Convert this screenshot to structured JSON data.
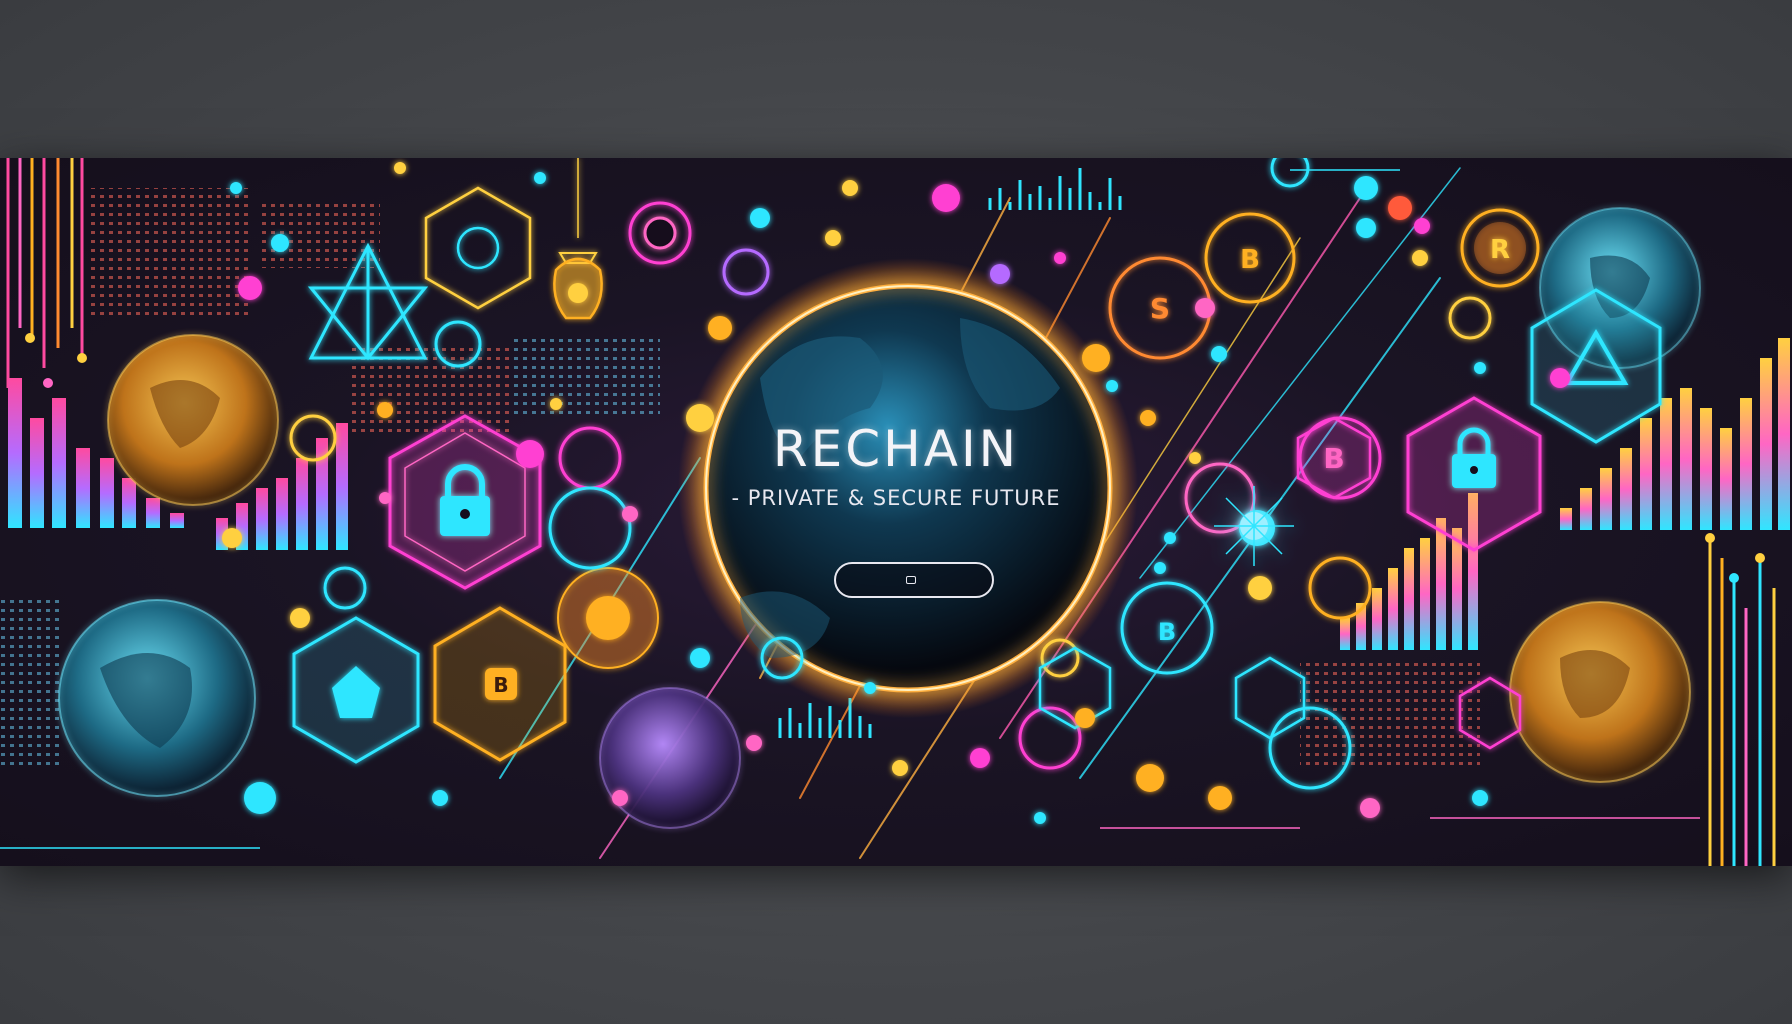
{
  "banner": {
    "title": "RECHAIN",
    "subtitle": "- PRIVATE & SECURE FUTURE",
    "cta_label": "",
    "cta_icon": "wallet-icon"
  },
  "colors": {
    "background": "#44464a",
    "banner_bg": "#1a1424",
    "cyan": "#2fe6ff",
    "magenta": "#ff3fd2",
    "orange": "#ffb020",
    "pink": "#ff4aa0",
    "purple": "#9a5cff"
  },
  "icons": [
    "globe-icon",
    "padlock-icon",
    "bitcoin-coin-icon",
    "hexagon-node-icon",
    "lightbulb-icon",
    "triangle-network-icon",
    "bar-chart-icon",
    "coin-r-icon"
  ]
}
